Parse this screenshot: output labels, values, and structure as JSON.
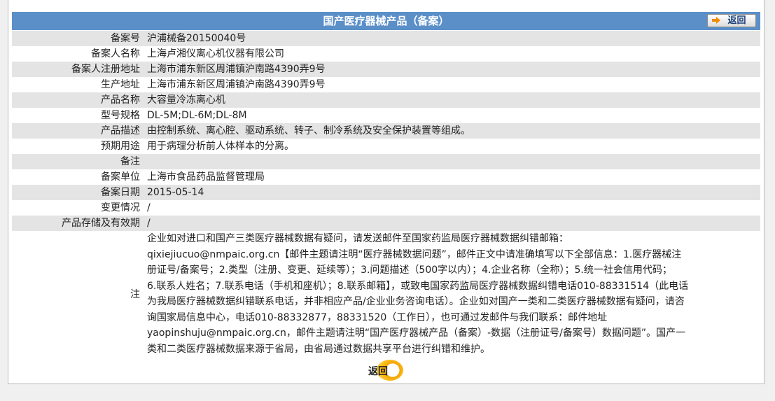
{
  "header": {
    "title": "国产医疗器械产品（备案）",
    "back_label": "返回"
  },
  "rows": [
    {
      "label": "备案号",
      "value": "沪浦械备20150040号"
    },
    {
      "label": "备案人名称",
      "value": "上海卢湘仪离心机仪器有限公司"
    },
    {
      "label": "备案人注册地址",
      "value": "上海市浦东新区周浦镇沪南路4390弄9号"
    },
    {
      "label": "生产地址",
      "value": "上海市浦东新区周浦镇沪南路4390弄9号"
    },
    {
      "label": "产品名称",
      "value": "大容量冷冻离心机"
    },
    {
      "label": "型号规格",
      "value": "DL-5M;DL-6M;DL-8M"
    },
    {
      "label": "产品描述",
      "value": "由控制系统、离心腔、驱动系统、转子、制冷系统及安全保护装置等组成。"
    },
    {
      "label": "预期用途",
      "value": "用于病理分析前人体样本的分离。"
    },
    {
      "label": "备注",
      "value": ""
    },
    {
      "label": "备案单位",
      "value": "上海市食品药品监督管理局"
    },
    {
      "label": "备案日期",
      "value": "2015-05-14"
    },
    {
      "label": "变更情况",
      "value": "/"
    },
    {
      "label": "产品存储及有效期",
      "value": "/"
    }
  ],
  "note": {
    "label": "注",
    "lines": [
      "企业如对进口和国产三类医疗器械数据有疑问，请发送邮件至国家药监局医疗器械数据纠错邮箱：",
      "qixiejiucuo@nmpaic.org.cn【邮件主题请注明“医疗器械数据问题”，邮件正文中请准确填写以下全部信息：1.医疗器械注",
      "册证号/备案号；2.类型（注册、变更、延续等）；3.问题描述（500字以内）；4.企业名称（全称）；5.统一社会信用代码；",
      "6.联系人姓名；7.联系电话（手机和座机）；8.联系邮箱】，或致电国家药监局医疗器械数据纠错电话010-88331514（此电话",
      "为我局医疗器械数据纠错联系电话，并非相应产品/企业业务咨询电话）。企业如对国产一类和二类医疗器械数据有疑问，请咨",
      "询国家局信息中心，电话010-88332877，88331520（工作日），也可通过发邮件与我们联系：邮件地址",
      "yaopinshuju@nmpaic.org.cn，邮件主题请注明“国产医疗器械产品（备案）-数据（注册证号/备案号）数据问题”。国产一",
      "类和二类医疗器械数据来源于省局，由省局通过数据共享平台进行纠错和维护。"
    ]
  },
  "footer": {
    "back_label": "返回"
  },
  "colors": {
    "header_bg": "#5b8fc8",
    "row_alt": "#e4e4e4",
    "button_accent": "#f3a300"
  }
}
